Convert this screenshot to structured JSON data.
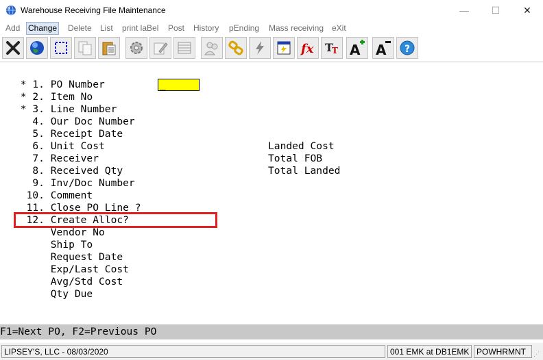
{
  "window": {
    "title": "Warehouse Receiving File Maintenance",
    "minimize_glyph": "—",
    "maximize_glyph": "☐",
    "close_glyph": "✕"
  },
  "menu": {
    "items": [
      "Add",
      "Change",
      "Delete",
      "List",
      "print laBel",
      "Post",
      "History",
      "pEnding",
      "Mass receiving",
      "eXit"
    ],
    "active": "Change"
  },
  "toolbar": {
    "buttons": [
      "exit-icon",
      "globe-icon",
      "select-icon",
      "copy-icon",
      "paste-icon",
      "settings-icon",
      "edit-icon",
      "grid-icon",
      "users-icon",
      "link-icon",
      "lightning-icon",
      "calculator-icon",
      "function-icon",
      "text-size-icon",
      "font-increase-icon",
      "font-decrease-icon",
      "help-icon"
    ]
  },
  "form": {
    "fields": [
      {
        "line": " * 1. PO Number"
      },
      {
        "line": " * 2. Item No"
      },
      {
        "line": " * 3. Line Number"
      },
      {
        "line": "   4. Our Doc Number"
      },
      {
        "line": "   5. Receipt Date"
      },
      {
        "line": "   6. Unit Cost"
      },
      {
        "line": "   7. Receiver"
      },
      {
        "line": "   8. Received Qty"
      },
      {
        "line": "   9. Inv/Doc Number"
      },
      {
        "line": "  10. Comment"
      },
      {
        "line": "  11. Close PO Line ?"
      },
      {
        "line": "  12. Create Alloc?"
      },
      {
        "line": "      Vendor No"
      },
      {
        "line": "      Ship To"
      },
      {
        "line": "      Request Date"
      },
      {
        "line": "      Exp/Last Cost"
      },
      {
        "line": "      Avg/Std Cost"
      },
      {
        "line": "      Qty Due"
      }
    ],
    "right_labels": [
      "Landed Cost",
      "Total FOB",
      "Total Landed"
    ],
    "po_input_value": "_"
  },
  "fkeys": "F1=Next PO, F2=Previous PO",
  "status": {
    "company": "LIPSEY'S, LLC - 08/03/2020",
    "session": "001 EMK at DB1EMK",
    "program": "POWHRMNT"
  },
  "colors": {
    "input_bg": "#ffff00",
    "highlight": "#e02020",
    "fkey_bar": "#c8c8c8"
  }
}
